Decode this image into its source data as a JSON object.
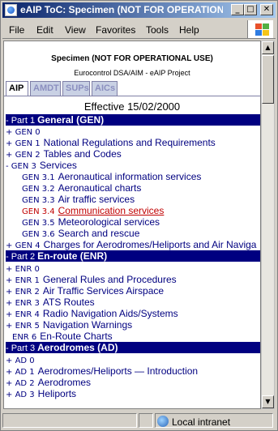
{
  "window": {
    "title": "eAIP ToC: Specimen (NOT FOR OPERATIONAL ..."
  },
  "menu": [
    "File",
    "Edit",
    "View",
    "Favorites",
    "Tools",
    "Help"
  ],
  "header": {
    "title": "Specimen (NOT FOR OPERATIONAL USE)",
    "subtitle": "Eurocontrol DSA/AIM - eAIP Project"
  },
  "tabs": [
    "AIP",
    "AMDT",
    "SUPs",
    "AICs"
  ],
  "effective": "Effective 15/02/2000",
  "parts": [
    {
      "label": "- Part 1",
      "name": "General (GEN)"
    },
    {
      "label": "- Part 2",
      "name": "En-route (ENR)"
    },
    {
      "label": "- Part 3",
      "name": "Aerodromes (AD)"
    }
  ],
  "gen": [
    {
      "prefix": "+",
      "code": "GEN 0",
      "label": ""
    },
    {
      "prefix": "+",
      "code": "GEN 1",
      "label": "National Regulations and Requirements"
    },
    {
      "prefix": "+",
      "code": "GEN 2",
      "label": "Tables and Codes"
    },
    {
      "prefix": "-",
      "code": "GEN 3",
      "label": "Services"
    },
    {
      "prefix": "",
      "code": "GEN 3.1",
      "label": "Aeronautical information services"
    },
    {
      "prefix": "",
      "code": "GEN 3.2",
      "label": "Aeronautical charts"
    },
    {
      "prefix": "",
      "code": "GEN 3.3",
      "label": "Air traffic services"
    },
    {
      "prefix": "",
      "code": "GEN 3.4",
      "label": "Communication services"
    },
    {
      "prefix": "",
      "code": "GEN 3.5",
      "label": "Meteorological services"
    },
    {
      "prefix": "",
      "code": "GEN 3.6",
      "label": "Search and rescue"
    },
    {
      "prefix": "+",
      "code": "GEN 4",
      "label": "Charges for Aerodromes/Heliports and Air Naviga"
    }
  ],
  "enr": [
    {
      "prefix": "+",
      "code": "ENR 0",
      "label": ""
    },
    {
      "prefix": "+",
      "code": "ENR 1",
      "label": "General Rules and Procedures"
    },
    {
      "prefix": "+",
      "code": "ENR 2",
      "label": "Air Traffic Services Airspace"
    },
    {
      "prefix": "+",
      "code": "ENR 3",
      "label": "ATS Routes"
    },
    {
      "prefix": "+",
      "code": "ENR 4",
      "label": "Radio Navigation Aids/Systems"
    },
    {
      "prefix": "+",
      "code": "ENR 5",
      "label": "Navigation Warnings"
    },
    {
      "prefix": "",
      "code": "ENR 6",
      "label": "En-Route Charts"
    }
  ],
  "ad": [
    {
      "prefix": "+",
      "code": "AD 0",
      "label": ""
    },
    {
      "prefix": "+",
      "code": "AD 1",
      "label": "Aerodromes/Heliports — Introduction"
    },
    {
      "prefix": "+",
      "code": "AD 2",
      "label": "Aerodromes"
    },
    {
      "prefix": "+",
      "code": "AD 3",
      "label": "Heliports"
    }
  ],
  "status": {
    "zone": "Local intranet"
  },
  "colors": {
    "link": "#000080",
    "selected": "#c00000",
    "part_bar": "#000080"
  }
}
